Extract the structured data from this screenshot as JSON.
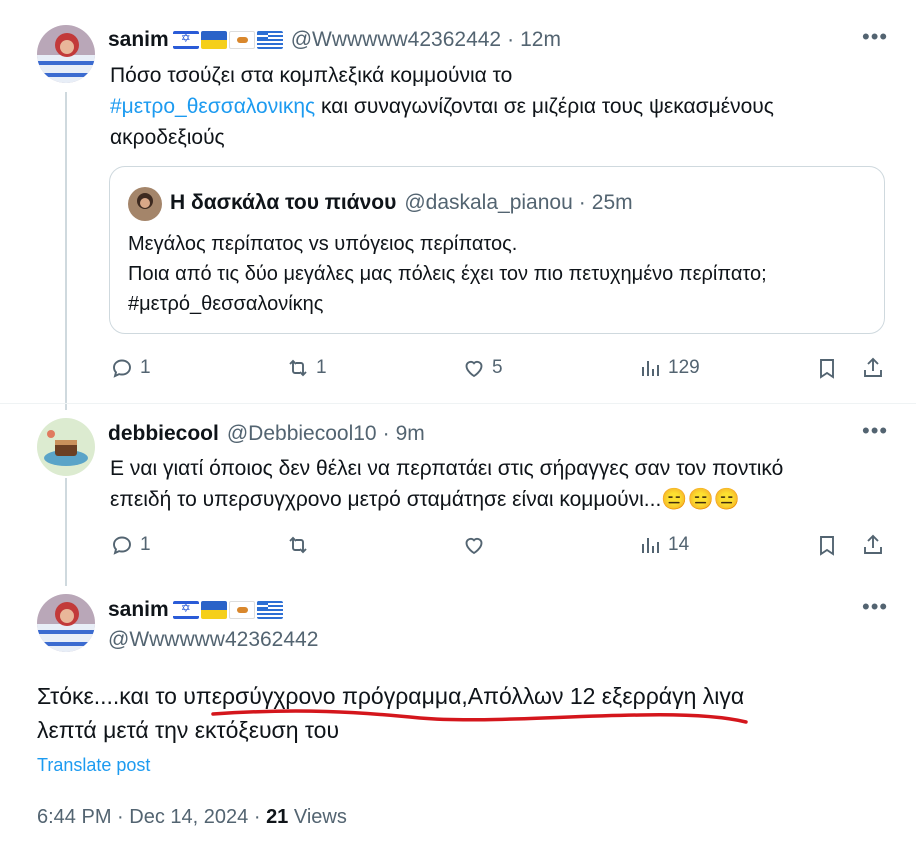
{
  "posts": [
    {
      "name": "sanim",
      "flags": [
        "israel-flag",
        "ukraine-flag",
        "cyprus-flag",
        "greece-flag"
      ],
      "handle": "@Wwwwww42362442",
      "sep": "·",
      "time": "12m",
      "text_line1": "Πόσο τσούζει στα κομπλεξικά κομμούνια το",
      "hashtag": "#μετρο_θεσσαλονικης",
      "text_line2_rest": " και συναγωνίζονται σε μιζέρια τους ψεκασμένους",
      "text_line3": "ακροδεξιούς",
      "quote": {
        "name": "Η δασκάλα του πιάνου",
        "handle": "@daskala_pianou",
        "sep": "·",
        "time": "25m",
        "line1": "Μεγάλος περίπατος vs υπόγειος περίπατος.",
        "line2": "Ποια από τις δύο μεγάλες μας πόλεις έχει τον πιο πετυχημένο περίπατο;",
        "line3": "#μετρό_θεσσαλονίκης"
      },
      "replies": "1",
      "reposts": "1",
      "likes": "5",
      "views": "129"
    },
    {
      "name": "debbiecool",
      "handle": "@Debbiecool10",
      "sep": "·",
      "time": "9m",
      "text_line1": "Ε ναι γιατί όποιος δεν θέλει να περπατάει στις σήραγγες σαν τον ποντικό",
      "text_line2": "επειδή το υπερσυγχρονο μετρό σταμάτησε είναι κομμούνι...😑😑😑",
      "replies": "1",
      "reposts": "",
      "likes": "",
      "views": "14"
    }
  ],
  "main_post": {
    "name": "sanim",
    "handle": "@Wwwwww42362442",
    "text_line1": "Στόκε....και το υπερσύγχρονο πρόγραμμα,Απόλλων 12 εξερράγη λιγα",
    "text_line2": "λεπτά μετά την εκτόξευση του",
    "translate": "Translate post",
    "time": "6:44 PM",
    "sep": "·",
    "date": "Dec 14, 2024",
    "views_count": "21",
    "views_label": "Views"
  },
  "colors": {
    "accent": "#1d9bf0",
    "muted": "#536471",
    "underline": "#d4161c"
  }
}
